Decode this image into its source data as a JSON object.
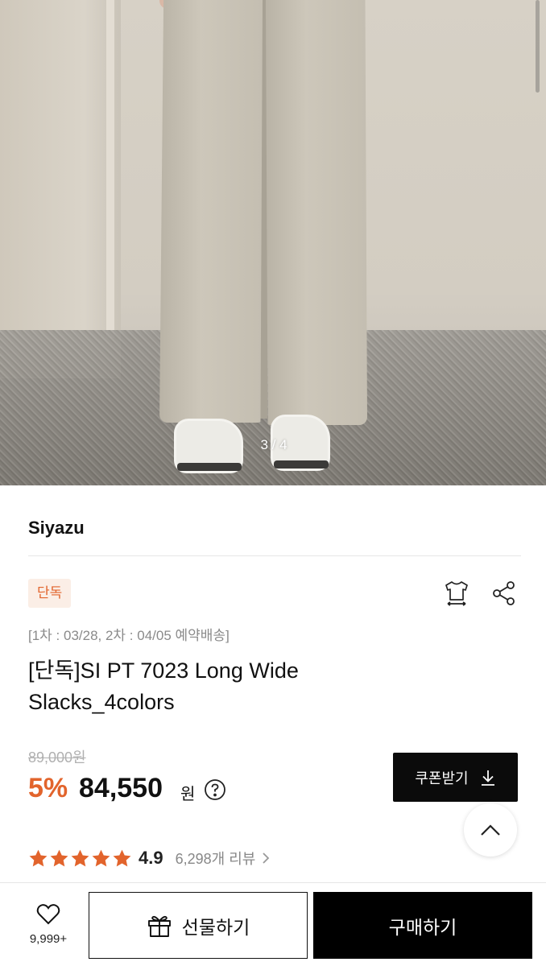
{
  "gallery": {
    "pager": "3 / 4"
  },
  "brand": "Siyazu",
  "badge": "단독",
  "shipping_notice": "[1차 : 03/28, 2차 : 04/05 예약배송]",
  "title_line1": "[단독]SI PT 7023 Long Wide",
  "title_line2": "Slacks_4colors",
  "price": {
    "original": "89,000원",
    "discount": "5%",
    "current": "84,550",
    "currency": "원"
  },
  "coupon_button": "쿠폰받기",
  "rating": {
    "stars": 5,
    "score": "4.9",
    "reviews": "6,298개 리뷰"
  },
  "bottom_bar": {
    "like_count": "9,999+",
    "gift_label": "선물하기",
    "buy_label": "구매하기"
  },
  "colors": {
    "accent": "#e2642c",
    "badge_bg": "#fbeee6",
    "dark": "#0b0b0b"
  },
  "icons": [
    "tshirt-size-icon",
    "share-icon",
    "question-icon",
    "download-icon",
    "chevron-up-icon",
    "star-icon",
    "chevron-right-icon",
    "heart-icon",
    "gift-icon"
  ]
}
